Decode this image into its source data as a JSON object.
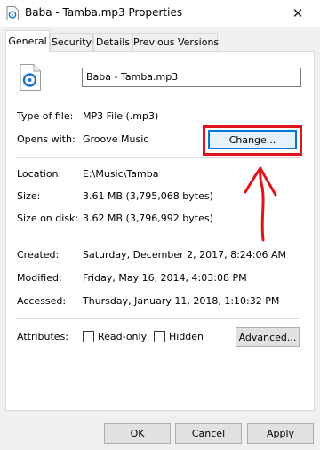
{
  "window": {
    "title": "Baba - Tamba.mp3 Properties",
    "close_glyph": "✕"
  },
  "tabs": [
    {
      "label": "General",
      "active": true
    },
    {
      "label": "Security"
    },
    {
      "label": "Details"
    },
    {
      "label": "Previous Versions"
    }
  ],
  "general": {
    "file_name": "Baba - Tamba.mp3",
    "type_label": "Type of file:",
    "type_value": "MP3 File (.mp3)",
    "opens_label": "Opens with:",
    "opens_value": "Groove Music",
    "change_button": "Change...",
    "location_label": "Location:",
    "location_value": "E:\\Music\\Tamba",
    "size_label": "Size:",
    "size_value": "3.61 MB (3,795,068 bytes)",
    "size_on_disk_label": "Size on disk:",
    "size_on_disk_value": "3.62 MB (3,796,992 bytes)",
    "created_label": "Created:",
    "created_value": "Saturday, December 2, 2017, 8:24:06 AM",
    "modified_label": "Modified:",
    "modified_value": "Friday, May 16, 2014, 4:03:08 PM",
    "accessed_label": "Accessed:",
    "accessed_value": "Thursday, January 11, 2018, 1:10:32 PM",
    "attributes_label": "Attributes:",
    "readonly_label": "Read-only",
    "readonly_checked": false,
    "hidden_label": "Hidden",
    "hidden_checked": false,
    "advanced_button": "Advanced..."
  },
  "footer": {
    "ok": "OK",
    "cancel": "Cancel",
    "apply": "Apply"
  },
  "colors": {
    "annotation": "#e0141b",
    "accent": "#0078d7",
    "groove_icon": "#1a73c9"
  },
  "icons": {
    "title_icon": "music-file-icon",
    "file_icon": "groove-music-file-icon",
    "annotation_arrow": "red-arrow-annotation"
  }
}
